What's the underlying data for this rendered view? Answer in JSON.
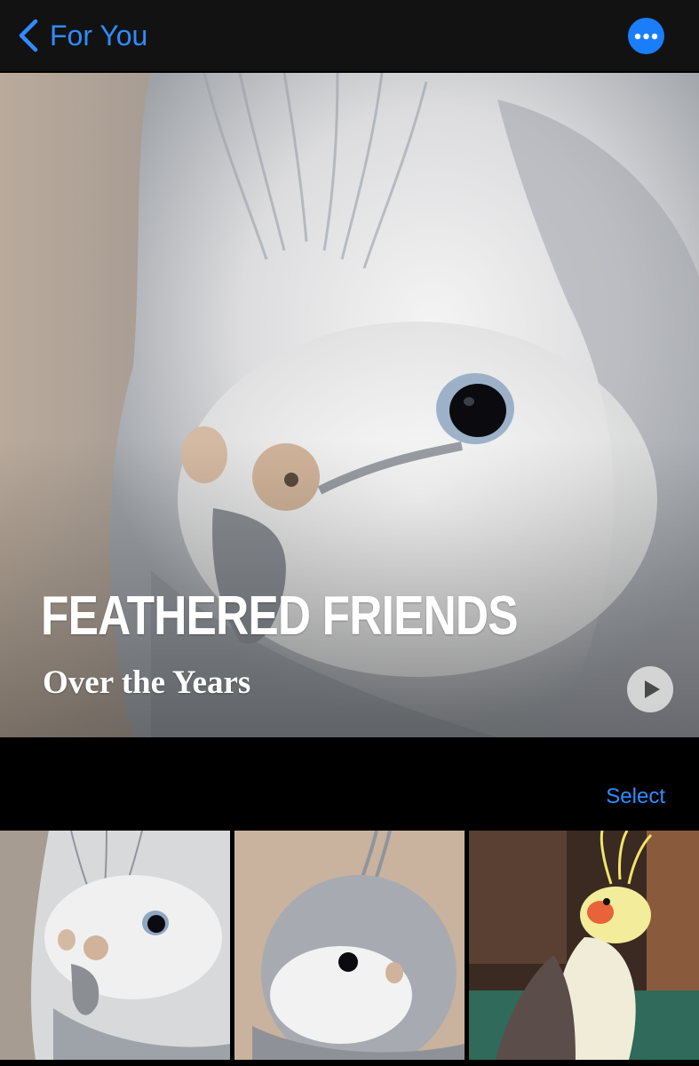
{
  "nav": {
    "back_label": "For You",
    "accent_color": "#2f8cff",
    "back_icon": "chevron-left-icon",
    "more_icon": "ellipsis-icon"
  },
  "memory": {
    "title": "FEATHERED FRIENDS",
    "subtitle": "Over the Years",
    "play_icon": "play-icon"
  },
  "grid": {
    "select_label": "Select",
    "photos": [
      {
        "subject": "white cockatiel close-up"
      },
      {
        "subject": "grey cockatiel face"
      },
      {
        "subject": "yellow cockatiel on perch"
      }
    ]
  }
}
